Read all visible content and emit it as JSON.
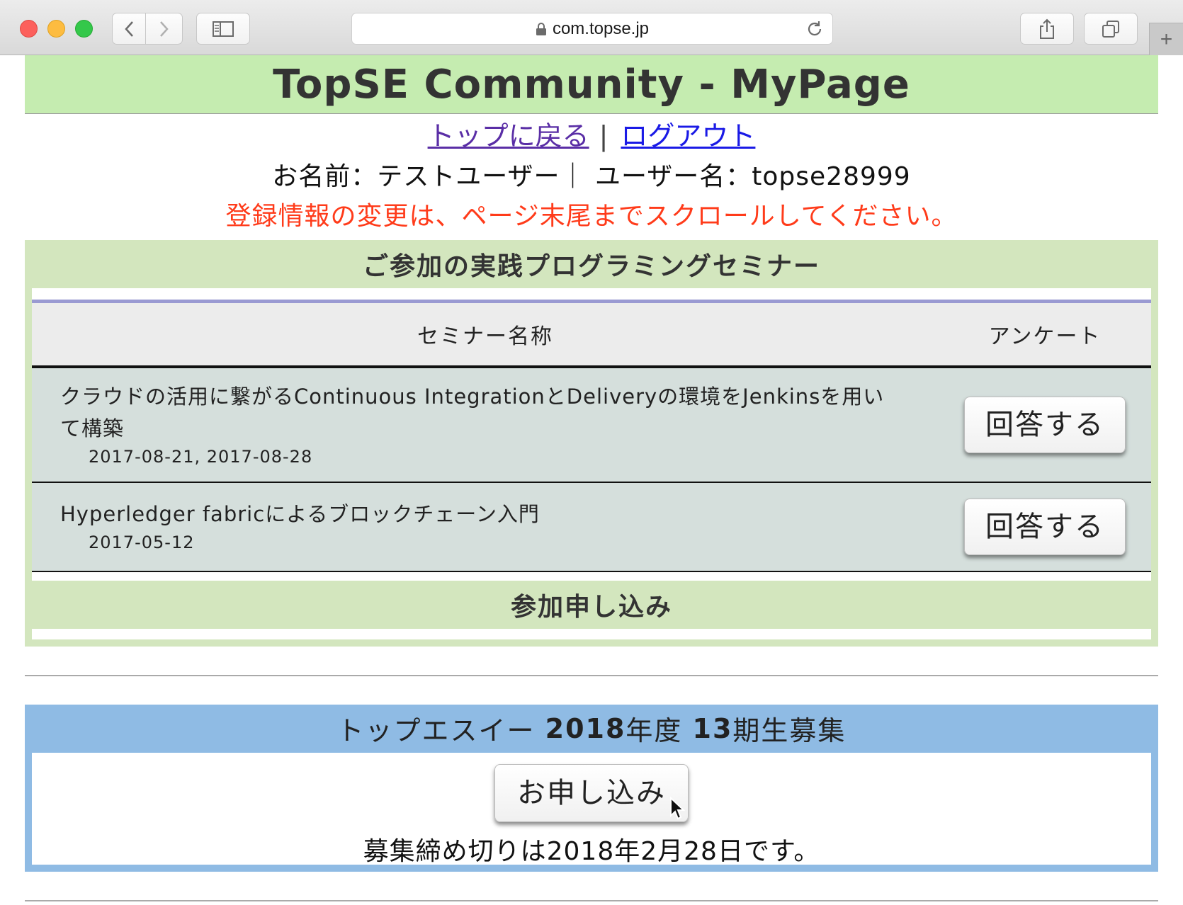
{
  "browser": {
    "url": "com.topse.jp",
    "new_tab_label": "+"
  },
  "header": {
    "title": "TopSE Community - MyPage"
  },
  "nav": {
    "top_link": "トップに戻る",
    "separator": "|",
    "logout_link": "ログアウト"
  },
  "user": {
    "info": "お名前：テストユーザー｜ ユーザー名：topse28999"
  },
  "notice": "登録情報の変更は、ページ末尾までスクロールしてください。",
  "seminars": {
    "heading": "ご参加の実践プログラミングセミナー",
    "columns": {
      "name": "セミナー名称",
      "survey": "アンケート"
    },
    "rows": [
      {
        "title": "クラウドの活用に繋がるContinuous IntegrationとDeliveryの環境をJenkinsを用いて構築",
        "dates": "2017-08-21, 2017-08-28",
        "answer_label": "回答する"
      },
      {
        "title": "Hyperledger fabricによるブロックチェーン入門",
        "dates": "2017-05-12",
        "answer_label": "回答する"
      }
    ],
    "apply_heading": "参加申し込み"
  },
  "recruit": {
    "heading_prefix": "トップエスイー ",
    "heading_year": "2018",
    "heading_mid": "年度 ",
    "heading_term": "13",
    "heading_suffix": "期生募集",
    "apply_label": "お申し込み",
    "deadline": "募集締め切りは2018年2月28日です。"
  },
  "colors": {
    "header_bg": "#c5ecb0",
    "seminar_panel_bg": "#d3e6be",
    "recruit_panel_bg": "#8fbbe4",
    "notice_text": "#ff3b1a",
    "visited_link": "#5a2ea6",
    "link": "#1a1ae6"
  }
}
